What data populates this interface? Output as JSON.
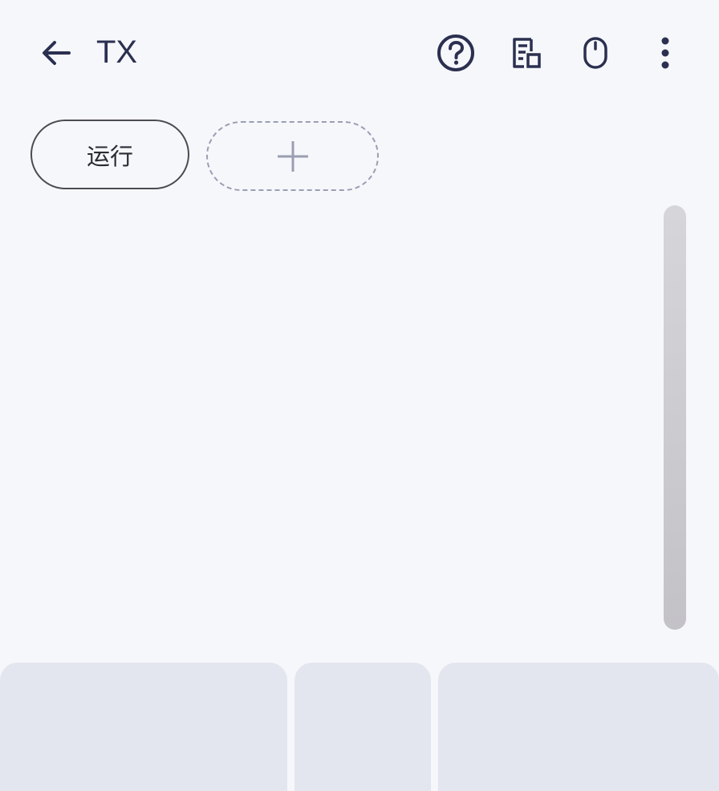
{
  "header": {
    "title": "TX",
    "icons": [
      "back-arrow-icon",
      "help-icon",
      "document-icon",
      "mouse-icon",
      "more-vert-icon"
    ]
  },
  "chips": {
    "run_label": "运行",
    "add_icon": "plus-icon"
  },
  "colors": {
    "background": "#f6f7fb",
    "text": "#2b3050",
    "panel": "#e4e6ef",
    "scrollbar": "#c8c7cc"
  }
}
